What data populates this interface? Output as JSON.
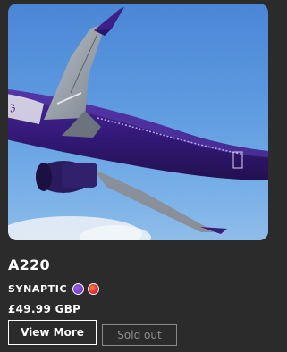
{
  "product": {
    "title": "A220",
    "brand": "SYNAPTIC",
    "price": "£49.99 GBP",
    "image_alt": "A220 aircraft livery in purple flying through a blue sky"
  },
  "swatches": [
    {
      "name": "purple",
      "color": "#7b3fc4"
    },
    {
      "name": "red-orange",
      "color": "#e8323c"
    }
  ],
  "actions": {
    "view_more_label": "View More",
    "sold_out_label": "Sold out"
  },
  "colors": {
    "background": "#2b2b2b",
    "livery_purple": "#3a1e7c",
    "text": "#ffffff",
    "muted": "#8f8f8f"
  }
}
